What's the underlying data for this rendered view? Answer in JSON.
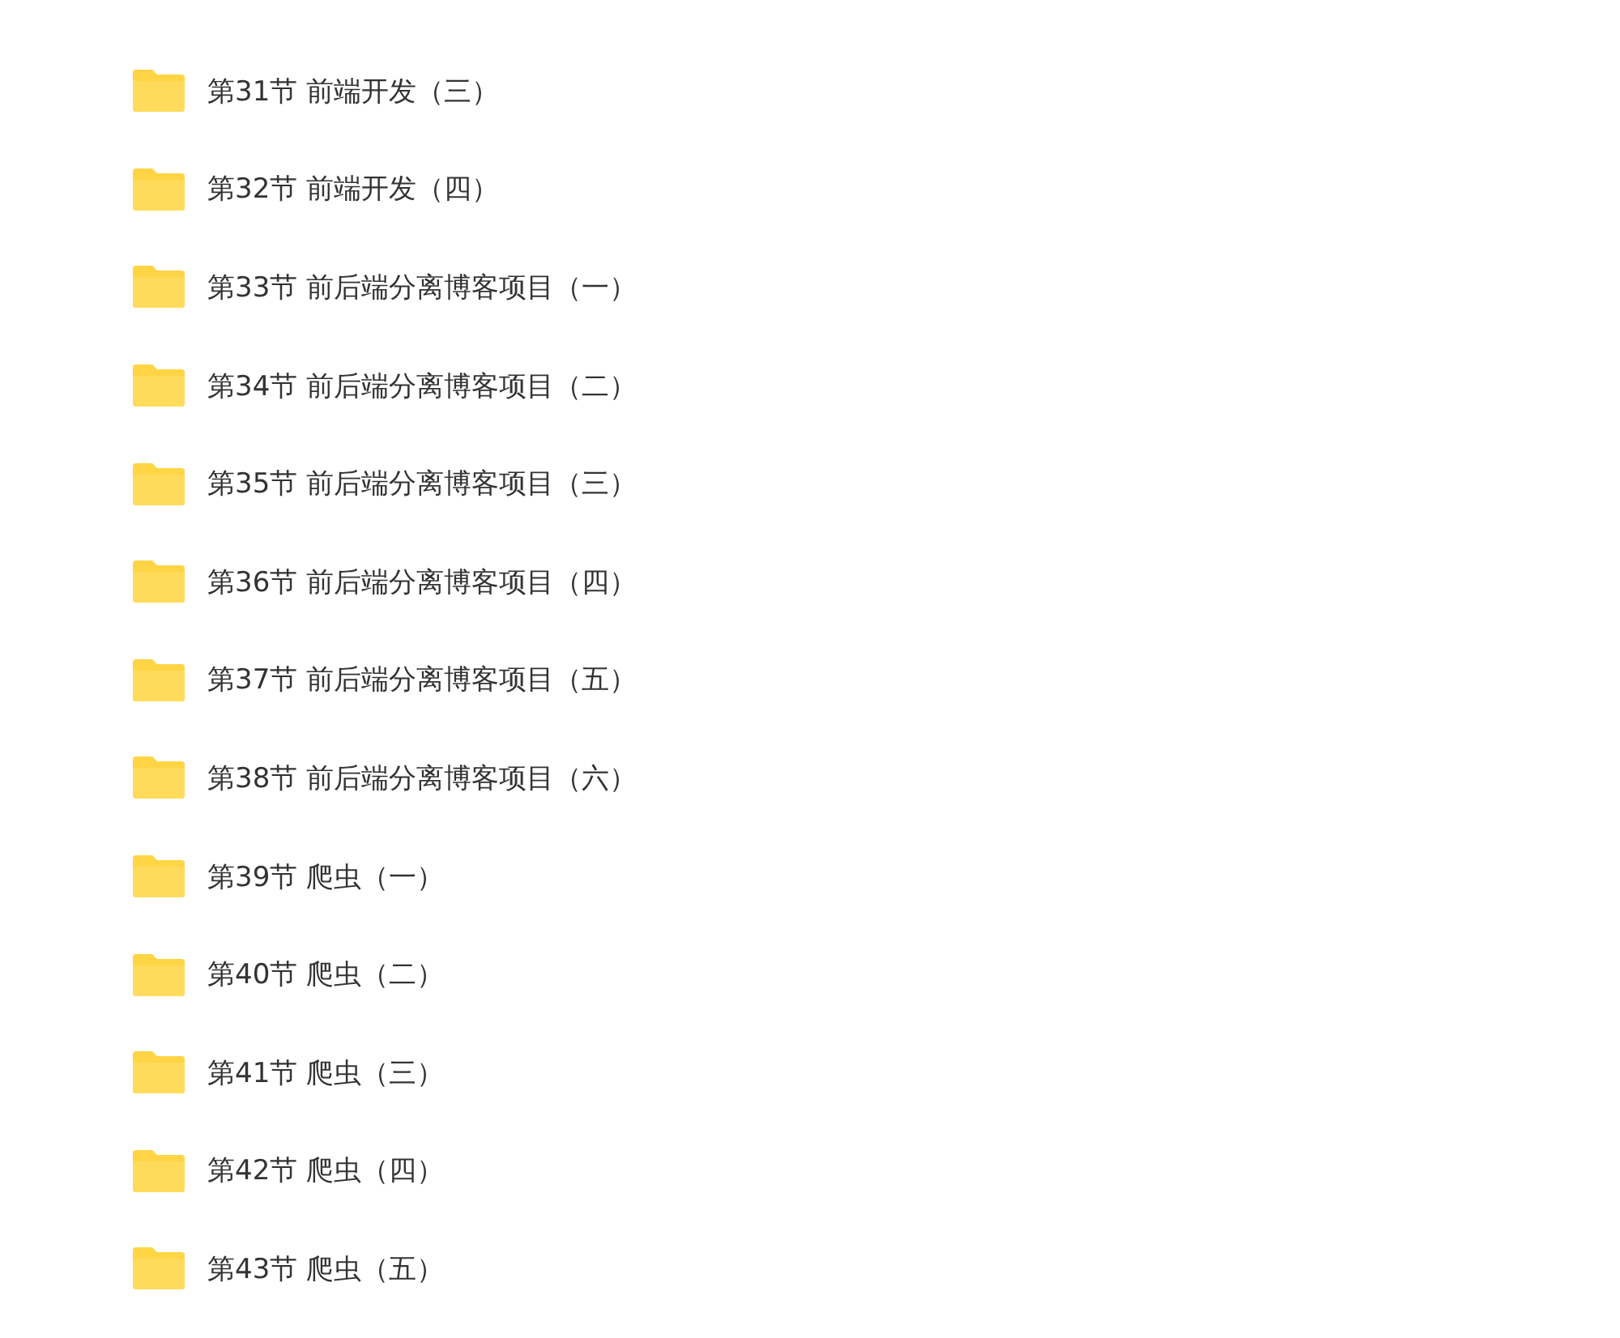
{
  "folders": [
    {
      "name": "第31节 前端开发（三）"
    },
    {
      "name": "第32节 前端开发（四）"
    },
    {
      "name": "第33节 前后端分离博客项目（一）"
    },
    {
      "name": "第34节 前后端分离博客项目（二）"
    },
    {
      "name": "第35节 前后端分离博客项目（三）"
    },
    {
      "name": "第36节 前后端分离博客项目（四）"
    },
    {
      "name": "第37节 前后端分离博客项目（五）"
    },
    {
      "name": "第38节 前后端分离博客项目（六）"
    },
    {
      "name": "第39节 爬虫（一）"
    },
    {
      "name": "第40节 爬虫（二）"
    },
    {
      "name": "第41节 爬虫（三）"
    },
    {
      "name": "第42节 爬虫（四）"
    },
    {
      "name": "第43节 爬虫（五）"
    }
  ]
}
